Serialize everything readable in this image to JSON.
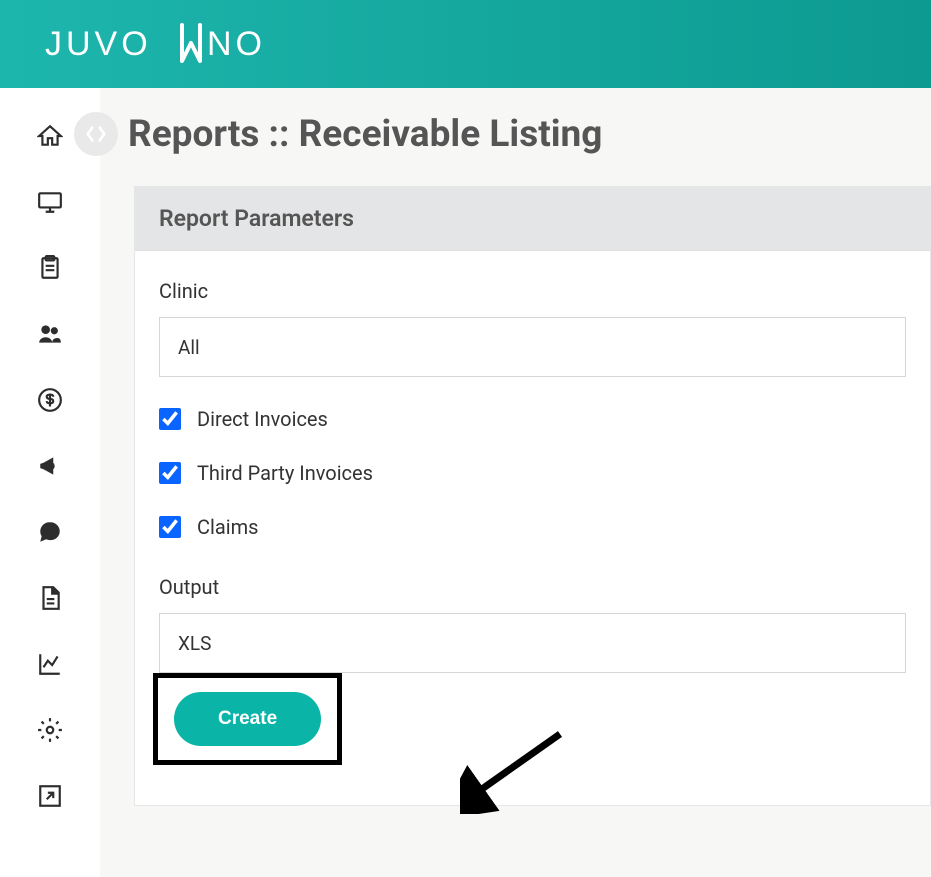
{
  "brand": "JUVONNO",
  "page_title": "Reports :: Receivable Listing",
  "panel": {
    "header": "Report Parameters",
    "clinic_label": "Clinic",
    "clinic_value": "All",
    "checkboxes": {
      "direct": "Direct Invoices",
      "third_party": "Third Party Invoices",
      "claims": "Claims"
    },
    "output_label": "Output",
    "output_value": "XLS",
    "create_label": "Create"
  }
}
